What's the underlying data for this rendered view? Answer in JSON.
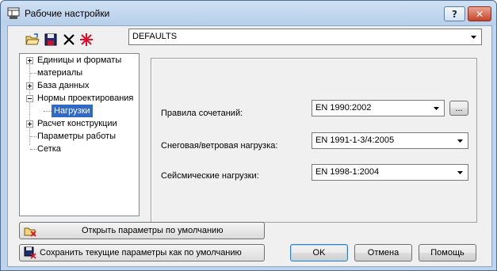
{
  "window": {
    "title": "Рабочие настройки",
    "help_label": "?",
    "close_label": "✕"
  },
  "toolbar": {
    "icons": [
      "open-folder-icon",
      "save-disk-icon",
      "delete-x-icon",
      "reset-star-icon"
    ],
    "preset_value": "DEFAULTS"
  },
  "tree": {
    "items": [
      {
        "label": "Единицы и форматы",
        "expander": "plus"
      },
      {
        "label": "материалы",
        "expander": "none"
      },
      {
        "label": "База данных",
        "expander": "plus"
      },
      {
        "label": "Нормы проектирования",
        "expander": "minus"
      },
      {
        "label": "Нагрузки",
        "expander": "none",
        "selected": true
      },
      {
        "label": "Расчет конструкции",
        "expander": "plus"
      },
      {
        "label": "Параметры работы",
        "expander": "none"
      },
      {
        "label": "Сетка",
        "expander": "none"
      }
    ]
  },
  "panel": {
    "fields": [
      {
        "label": "Правила сочетаний:",
        "value": "EN 1990:2002"
      },
      {
        "label": "Снеговая/ветровая нагрузка:",
        "value": "EN 1991-1-3/4:2005"
      },
      {
        "label": "Сейсмические нагрузки:",
        "value": "EN 1998-1:2004"
      }
    ],
    "ellipsis_label": "..."
  },
  "buttons": {
    "open_defaults_label": "Открыть параметры по умолчанию",
    "save_defaults_label": "Сохранить текущие параметры как по умолчанию",
    "ok_label": "OK",
    "cancel_label": "Отмена",
    "help_label": "Помощь"
  }
}
